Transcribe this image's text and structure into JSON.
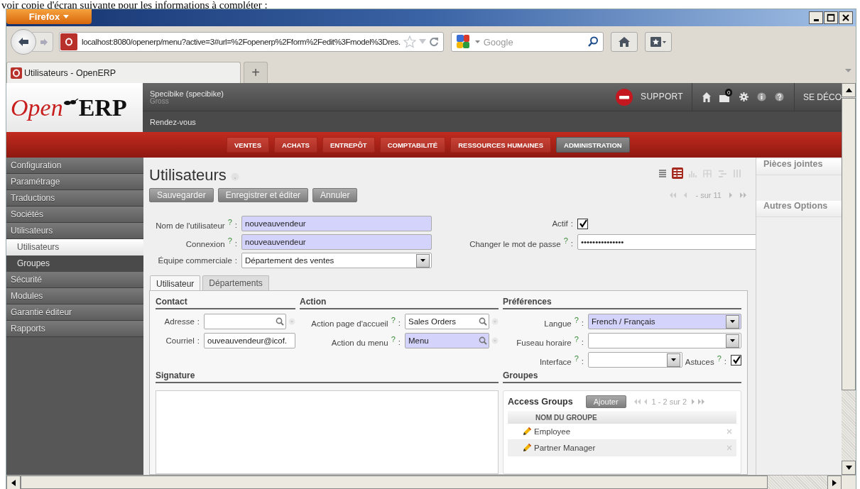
{
  "caption": "voir copie d'écran suivante pour les informations à compléter :",
  "browser": {
    "menu_button": "Firefox",
    "url": "localhost:8080/openerp/menu?active=3#url=%2Fopenerp%2Fform%2Fedit%3Fmodel%3Dres.",
    "search_placeholder": "Google",
    "tab_title": "Utilisateurs - OpenERP",
    "new_tab": "+"
  },
  "logo": {
    "open": "Open",
    "erp": "ERP"
  },
  "header": {
    "company": "Specibike (specibike)",
    "user": "Gross",
    "shortcut": "Rendez-vous",
    "support": "SUPPORT",
    "notification_count": "0",
    "logout": "SE DÉCO"
  },
  "main_menu": [
    {
      "label": "VENTES",
      "selected": false
    },
    {
      "label": "ACHATS",
      "selected": false
    },
    {
      "label": "ENTREPÔT",
      "selected": false
    },
    {
      "label": "COMPTABILITÉ",
      "selected": false
    },
    {
      "label": "RESSOURCES HUMAINES",
      "selected": false
    },
    {
      "label": "ADMINISTRATION",
      "selected": true
    }
  ],
  "sidebar": [
    {
      "label": "Configuration",
      "selected": false
    },
    {
      "label": "Paramétrage",
      "selected": false
    },
    {
      "label": "Traductions",
      "selected": false
    },
    {
      "label": "Sociétés",
      "selected": false
    },
    {
      "label": "Utilisateurs",
      "selected": false,
      "children": [
        {
          "label": "Utilisateurs",
          "selected": true
        },
        {
          "label": "Groupes",
          "selected": false
        }
      ]
    },
    {
      "label": "Sécurité",
      "selected": false
    },
    {
      "label": "Modules",
      "selected": false
    },
    {
      "label": "Garantie éditeur",
      "selected": false
    },
    {
      "label": "Rapports",
      "selected": false
    }
  ],
  "page": {
    "title": "Utilisateurs",
    "buttons": [
      "Sauvegarder",
      "Enregistrer et éditer",
      "Annuler"
    ],
    "view_modes": [
      {
        "kind": "list",
        "selected": false
      },
      {
        "kind": "form",
        "selected": true
      },
      {
        "kind": "graph",
        "selected": false
      },
      {
        "kind": "calendar",
        "selected": false
      },
      {
        "kind": "gantt",
        "selected": false
      },
      {
        "kind": "columns",
        "selected": false
      }
    ],
    "pager": "- sur 11"
  },
  "main_fields": [
    {
      "label": "Nom de l'utilisateur",
      "help": "?",
      "colon": ":",
      "kind": "text",
      "value": "nouveauvendeur",
      "required": true
    },
    {
      "label": "Connexion",
      "help": "?",
      "colon": ":",
      "kind": "text",
      "value": "nouveauvendeur",
      "required": true
    },
    {
      "label": "Équipe commerciale",
      "colon": ":",
      "kind": "select",
      "value": "Département des ventes",
      "required": false
    }
  ],
  "side_fields": [
    {
      "label": "Actif",
      "colon": ":",
      "kind": "checkbox",
      "checked": true
    },
    {
      "label": "Changer le mot de passe",
      "help": "?",
      "colon": ":",
      "kind": "text",
      "value": "•••••••••••••••",
      "required": false
    }
  ],
  "tabs": [
    {
      "label": "Utilisateur",
      "selected": true
    },
    {
      "label": "Départements",
      "selected": false
    }
  ],
  "contact": {
    "title": "Contact",
    "fields": [
      {
        "label": "Adresse",
        "colon": ":",
        "kind": "lookup",
        "required": false
      },
      {
        "label": "Courriel",
        "colon": ":",
        "kind": "text",
        "value": "ouveauvendeur@icof.",
        "required": false
      }
    ]
  },
  "action": {
    "title": "Action",
    "fields": [
      {
        "label": "Action page d'accueil",
        "help": "?",
        "colon": ":",
        "kind": "lookup",
        "value": "Sales Orders",
        "required": false
      },
      {
        "label": "Action du menu",
        "help": "?",
        "colon": ":",
        "kind": "lookup",
        "value": "Menu",
        "required": true
      }
    ]
  },
  "preferences": {
    "title": "Préférences",
    "rows": [
      [
        {
          "label": "Langue",
          "help": "?",
          "colon": ":",
          "kind": "select",
          "value": "French / Français",
          "required": true
        }
      ],
      [
        {
          "label": "Fuseau horaire",
          "help": "?",
          "colon": ":",
          "kind": "select",
          "required": false
        }
      ],
      [
        {
          "label": "Interface",
          "help": "?",
          "colon": ":",
          "kind": "select",
          "required": false
        },
        {
          "label": "Astuces",
          "help": "?",
          "colon": ":",
          "kind": "checkbox",
          "checked": true
        }
      ]
    ]
  },
  "signature": {
    "title": "Signature"
  },
  "groups": {
    "title": "Groupes",
    "list_title": "Access Groups",
    "add_button": "Ajouter",
    "pager": "1 - 2 sur 2",
    "column": "NOM DU GROUPE",
    "rows": [
      {
        "name": "Employee"
      },
      {
        "name": "Partner Manager"
      }
    ]
  },
  "right_panel": [
    "Pièces jointes",
    "Autres Options"
  ]
}
